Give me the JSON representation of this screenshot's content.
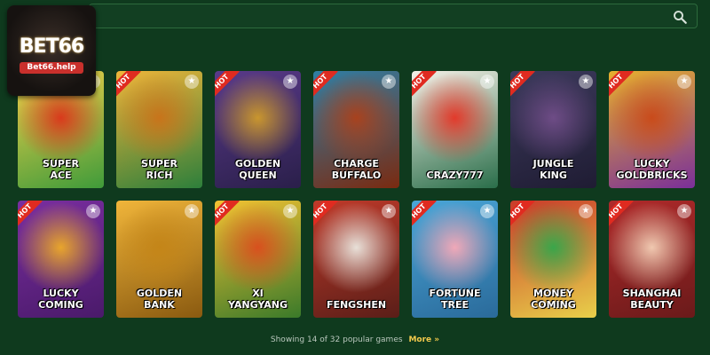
{
  "logo": {
    "brand": "BET66",
    "domain": "Bet66.help"
  },
  "search": {
    "icon": "search-icon"
  },
  "hot_label": "HOT",
  "games": [
    {
      "title": "SUPER\nACE",
      "hot": true,
      "colors": [
        "#f6d14a",
        "#d93a1c",
        "#3f9b3a"
      ]
    },
    {
      "title": "SUPER\nRICH",
      "hot": true,
      "colors": [
        "#f0b53a",
        "#c8741b",
        "#2d7f3b"
      ]
    },
    {
      "title": "GOLDEN\nQUEEN",
      "hot": true,
      "colors": [
        "#5a3a8a",
        "#c9962e",
        "#2a1f4a"
      ]
    },
    {
      "title": "CHARGE\nBUFFALO",
      "hot": true,
      "colors": [
        "#2f7fa6",
        "#a8421e",
        "#7a2a10"
      ]
    },
    {
      "title": "CRAZY777",
      "hot": true,
      "colors": [
        "#f6f1e8",
        "#e23a2b",
        "#2a6e4a"
      ]
    },
    {
      "title": "JUNGLE\nKING",
      "hot": true,
      "colors": [
        "#3c3a5c",
        "#6e4c86",
        "#1f1c33"
      ]
    },
    {
      "title": "LUCKY\nGOLDBRICKS",
      "hot": true,
      "colors": [
        "#e8b02c",
        "#c94b1b",
        "#7a2f9a"
      ]
    },
    {
      "title": "LUCKY\nCOMING",
      "hot": true,
      "colors": [
        "#7a2ea0",
        "#e8a52c",
        "#4a1a6a"
      ]
    },
    {
      "title": "GOLDEN\nBANK",
      "hot": false,
      "colors": [
        "#f0b53a",
        "#c48518",
        "#8a5a10"
      ]
    },
    {
      "title": "XI\nYANGYANG",
      "hot": true,
      "colors": [
        "#f4c232",
        "#d8501e",
        "#3a7a2a"
      ]
    },
    {
      "title": "FENGSHEN",
      "hot": true,
      "colors": [
        "#c03a2a",
        "#e8e0d8",
        "#5a1e18"
      ]
    },
    {
      "title": "FORTUNE\nTREE",
      "hot": true,
      "colors": [
        "#4aa6d8",
        "#f0a8b8",
        "#2a6a9a"
      ]
    },
    {
      "title": "MONEY\nCOMING",
      "hot": true,
      "colors": [
        "#c93a2a",
        "#3aa64a",
        "#e8d04a"
      ]
    },
    {
      "title": "SHANGHAI\nBEAUTY",
      "hot": true,
      "colors": [
        "#b02a2a",
        "#f0c8b0",
        "#6a1a1a"
      ]
    }
  ],
  "footer": {
    "showing": "Showing 14 of 32 popular games",
    "more": "More",
    "more_icon": "chevron-double-down-icon"
  }
}
